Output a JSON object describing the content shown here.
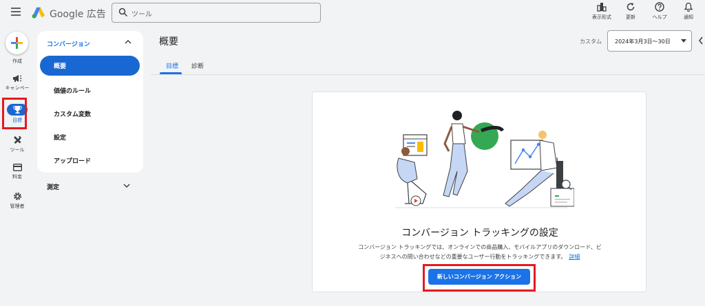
{
  "header": {
    "brand": "Google 広告",
    "search_placeholder": "ツール",
    "tools": [
      {
        "label": "表示形式",
        "icon": "view-format-icon"
      },
      {
        "label": "更新",
        "icon": "refresh-icon"
      },
      {
        "label": "ヘルプ",
        "icon": "help-icon"
      },
      {
        "label": "通知",
        "icon": "bell-icon"
      }
    ]
  },
  "rail": {
    "create": "作成",
    "items": [
      {
        "label": "キャンペー",
        "icon": "megaphone-icon"
      },
      {
        "label": "目標",
        "icon": "trophy-icon"
      },
      {
        "label": "ツール",
        "icon": "tools-icon"
      },
      {
        "label": "料金",
        "icon": "credit-card-icon"
      },
      {
        "label": "管理者",
        "icon": "gear-icon"
      }
    ]
  },
  "nav": {
    "section": "コンバージョン",
    "items": [
      "概要",
      "価値のルール",
      "カスタム変数",
      "設定",
      "アップロード"
    ],
    "section2": "測定"
  },
  "main": {
    "title": "概要",
    "tabs": [
      "目標",
      "診断"
    ],
    "date_label": "カスタム",
    "date_range": "2024年3月3日〜30日"
  },
  "card": {
    "title": "コンバージョン トラッキングの設定",
    "desc_line1": "コンバージョン トラッキングでは、オンラインでの商品購入、モバイルアプリのダウンロード、ビ",
    "desc_line2": "ジネスへの問い合わせなどの重要なユーザー行動をトラッキングできます。",
    "link": "詳細",
    "cta": "新しいコンバージョン アクション"
  },
  "colors": {
    "accent": "#1a73e8",
    "highlight": "#e5191f"
  }
}
